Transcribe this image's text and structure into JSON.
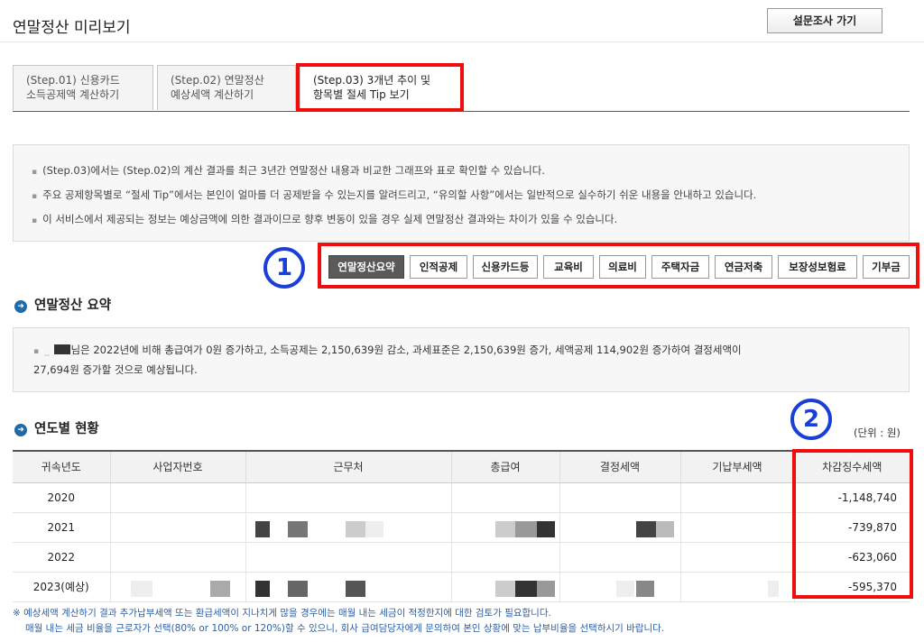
{
  "page": {
    "title": "연말정산 미리보기",
    "survey_button": "설문조사 가기"
  },
  "tabs": [
    {
      "line1": "(Step.01) 신용카드",
      "line2": "소득공제액 계산하기"
    },
    {
      "line1": "(Step.02) 연말정산",
      "line2": "예상세액 계산하기"
    },
    {
      "line1": "(Step.03) 3개년 추이 및",
      "line2": "항목별 절세 Tip 보기"
    }
  ],
  "info": [
    "(Step.03)에서는 (Step.02)의 계산 결과를 최근 3년간 연말정산 내용과 비교한 그래프와 표로 확인할 수 있습니다.",
    "주요 공제항목별로 “절세 Tip”에서는 본인이 얼마를 더 공제받을 수 있는지를 알려드리고, “유의할 사항”에서는 일반적으로 실수하기 쉬운 내용을 안내하고 있습니다.",
    "이 서비스에서 제공되는 정보는 예상금액에 의한 결과이므로 향후 변동이 있을 경우 실제 연말정산 결과와는 차이가 있을 수 있습니다."
  ],
  "annotations": {
    "one": "1",
    "two": "2"
  },
  "filters": [
    "연말정산요약",
    "인적공제",
    "신용카드등",
    "교육비",
    "의료비",
    "주택자금",
    "연금저축",
    "보장성보험료",
    "기부금"
  ],
  "summary": {
    "title": "연말정산 요약",
    "text_after_name": "님은 2022년에 비해 총급여가 0원 증가하고, 소득공제는 2,150,639원 감소, 과세표준은 2,150,639원 증가, 세액공제 114,902원 증가하여 결정세액이",
    "text_line2": "27,694원 증가할 것으로 예상됩니다."
  },
  "yearly": {
    "title": "연도별 현황",
    "unit": "(단위 : 원)",
    "columns": [
      "귀속년도",
      "사업자번호",
      "근무처",
      "총급여",
      "결정세액",
      "기납부세액",
      "차감징수세액"
    ],
    "rows": [
      {
        "year": "2020",
        "deduct": "-1,148,740"
      },
      {
        "year": "2021",
        "deduct": "-739,870"
      },
      {
        "year": "2022",
        "deduct": "-623,060"
      },
      {
        "year": "2023(예상)",
        "deduct": "-595,370"
      }
    ]
  },
  "notes": {
    "line1": "※ 예상세액 계산하기 결과 추가납부세액 또는 환급세액이 지나치게 많을 경우에는 매월 내는 세금이 적정한지에 대한 검토가 필요합니다.",
    "line2": "매월 내는 세금 비율을 근로자가 선택(80% or 100% or 120%)할 수 있으니, 회사 급여담당자에게 문의하여 본인 상황에 맞는 납부비율을 선택하시기 바랍니다."
  },
  "colors": {
    "accent": "#1f6aa8",
    "highlight_red": "#f20d0d",
    "annotation_blue": "#1a3fd6"
  }
}
